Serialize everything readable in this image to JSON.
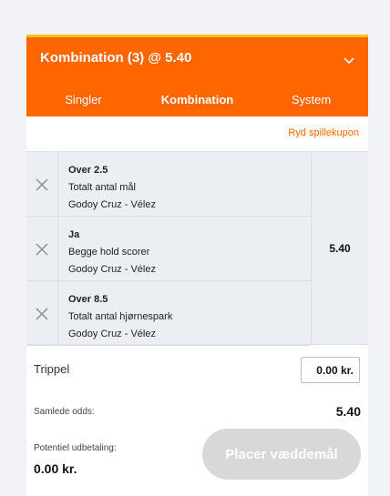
{
  "header": {
    "title": "Kombination (3) @ 5.40",
    "collapse_icon": "chevron-down-icon"
  },
  "tabs": [
    {
      "label": "Singler",
      "active": false
    },
    {
      "label": "Kombination",
      "active": true
    },
    {
      "label": "System",
      "active": false
    }
  ],
  "clear_label": "Ryd spillekupon",
  "bets": [
    {
      "selection": "Over 2.5",
      "market": "Totalt antal mål",
      "event": "Godoy Cruz - Vélez"
    },
    {
      "selection": "Ja",
      "market": "Begge hold scorer",
      "event": "Godoy Cruz - Vélez"
    },
    {
      "selection": "Over 8.5",
      "market": "Totalt antal hjørnespark",
      "event": "Godoy Cruz - Vélez"
    }
  ],
  "combined_odds": "5.40",
  "stake": {
    "label": "Trippel",
    "value": "0.00 kr."
  },
  "total_odds": {
    "label": "Samlede odds:",
    "value": "5.40"
  },
  "payout": {
    "label": "Potentiel udbetaling:",
    "value": "0.00 kr."
  },
  "place_button_label": "Placer væddemål",
  "colors": {
    "brand": "#ff6600",
    "accent_strip": "#ffc400",
    "disabled": "#d7d8da"
  }
}
